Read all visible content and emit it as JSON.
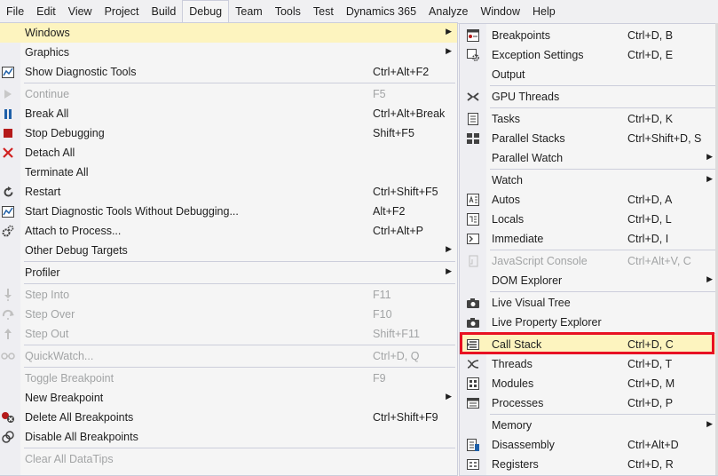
{
  "menubar": {
    "items": [
      "File",
      "Edit",
      "View",
      "Project",
      "Build",
      "Debug",
      "Team",
      "Tools",
      "Test",
      "Dynamics 365",
      "Analyze",
      "Window",
      "Help"
    ],
    "active": "Debug"
  },
  "debug_menu": {
    "items": [
      {
        "label": "Windows",
        "shortcut": "",
        "submenu": true,
        "icon": "",
        "state": "highlighted"
      },
      {
        "label": "Graphics",
        "shortcut": "",
        "submenu": true,
        "icon": ""
      },
      {
        "label": "Show Diagnostic Tools",
        "shortcut": "Ctrl+Alt+F2",
        "icon": "diagnostic-tools-icon"
      },
      {
        "label": "Continue",
        "shortcut": "F5",
        "icon": "play-icon",
        "state": "disabled"
      },
      {
        "label": "Break All",
        "shortcut": "Ctrl+Alt+Break",
        "icon": "pause-icon"
      },
      {
        "label": "Stop Debugging",
        "shortcut": "Shift+F5",
        "icon": "stop-icon"
      },
      {
        "label": "Detach All",
        "shortcut": "",
        "icon": "close-icon"
      },
      {
        "label": "Terminate All",
        "shortcut": "",
        "icon": ""
      },
      {
        "label": "Restart",
        "shortcut": "Ctrl+Shift+F5",
        "icon": "restart-icon"
      },
      {
        "label": "Start Diagnostic Tools Without Debugging...",
        "shortcut": "Alt+F2",
        "icon": "diagnostic-tools-icon"
      },
      {
        "label": "Attach to Process...",
        "shortcut": "Ctrl+Alt+P",
        "icon": "gears-icon"
      },
      {
        "label": "Other Debug Targets",
        "shortcut": "",
        "submenu": true,
        "icon": ""
      },
      {
        "label": "Profiler",
        "shortcut": "",
        "submenu": true,
        "icon": ""
      },
      {
        "label": "Step Into",
        "shortcut": "F11",
        "icon": "step-into-icon",
        "state": "disabled"
      },
      {
        "label": "Step Over",
        "shortcut": "F10",
        "icon": "step-over-icon",
        "state": "disabled"
      },
      {
        "label": "Step Out",
        "shortcut": "Shift+F11",
        "icon": "step-out-icon",
        "state": "disabled"
      },
      {
        "label": "QuickWatch...",
        "shortcut": "Ctrl+D, Q",
        "icon": "glasses-icon",
        "state": "disabled"
      },
      {
        "label": "Toggle Breakpoint",
        "shortcut": "F9",
        "icon": "",
        "state": "disabled"
      },
      {
        "label": "New Breakpoint",
        "shortcut": "",
        "submenu": true,
        "icon": ""
      },
      {
        "label": "Delete All Breakpoints",
        "shortcut": "Ctrl+Shift+F9",
        "icon": "delete-breakpoints-icon"
      },
      {
        "label": "Disable All Breakpoints",
        "shortcut": "",
        "icon": "disable-breakpoints-icon"
      },
      {
        "label": "Clear All DataTips",
        "shortcut": "",
        "icon": "",
        "state": "disabled"
      }
    ]
  },
  "windows_menu": {
    "items": [
      {
        "label": "Breakpoints",
        "shortcut": "Ctrl+D, B",
        "icon": "breakpoints-window-icon"
      },
      {
        "label": "Exception Settings",
        "shortcut": "Ctrl+D, E",
        "icon": "exception-settings-icon"
      },
      {
        "label": "Output",
        "shortcut": "",
        "icon": ""
      },
      {
        "label": "GPU Threads",
        "shortcut": "",
        "icon": "gpu-threads-icon"
      },
      {
        "label": "Tasks",
        "shortcut": "Ctrl+D, K",
        "icon": "tasks-icon"
      },
      {
        "label": "Parallel Stacks",
        "shortcut": "Ctrl+Shift+D, S",
        "icon": "parallel-stacks-icon"
      },
      {
        "label": "Parallel Watch",
        "shortcut": "",
        "submenu": true,
        "icon": ""
      },
      {
        "label": "Watch",
        "shortcut": "",
        "submenu": true,
        "icon": ""
      },
      {
        "label": "Autos",
        "shortcut": "Ctrl+D, A",
        "icon": "autos-icon"
      },
      {
        "label": "Locals",
        "shortcut": "Ctrl+D, L",
        "icon": "locals-icon"
      },
      {
        "label": "Immediate",
        "shortcut": "Ctrl+D, I",
        "icon": "immediate-icon"
      },
      {
        "label": "JavaScript Console",
        "shortcut": "Ctrl+Alt+V, C",
        "icon": "javascript-console-icon",
        "state": "disabled"
      },
      {
        "label": "DOM Explorer",
        "shortcut": "",
        "submenu": true,
        "icon": ""
      },
      {
        "label": "Live Visual Tree",
        "shortcut": "",
        "icon": "camera-icon"
      },
      {
        "label": "Live Property Explorer",
        "shortcut": "",
        "icon": "camera-icon"
      },
      {
        "label": "Call Stack",
        "shortcut": "Ctrl+D, C",
        "icon": "call-stack-icon",
        "state": "highlighted"
      },
      {
        "label": "Threads",
        "shortcut": "Ctrl+D, T",
        "icon": "threads-icon"
      },
      {
        "label": "Modules",
        "shortcut": "Ctrl+D, M",
        "icon": "modules-icon"
      },
      {
        "label": "Processes",
        "shortcut": "Ctrl+D, P",
        "icon": "processes-icon"
      },
      {
        "label": "Memory",
        "shortcut": "",
        "submenu": true,
        "icon": ""
      },
      {
        "label": "Disassembly",
        "shortcut": "Ctrl+Alt+D",
        "icon": "disassembly-icon"
      },
      {
        "label": "Registers",
        "shortcut": "Ctrl+D, R",
        "icon": "registers-icon"
      }
    ]
  },
  "colors": {
    "menu_bg": "#f5f5f5",
    "highlight_bg": "#fdf4bf",
    "disabled_text": "#a2a4a5",
    "annotation_border": "#e81123",
    "stop_icon": "#b51a1a",
    "pause_icon": "#1e5fa8",
    "close_icon": "#d02020"
  }
}
